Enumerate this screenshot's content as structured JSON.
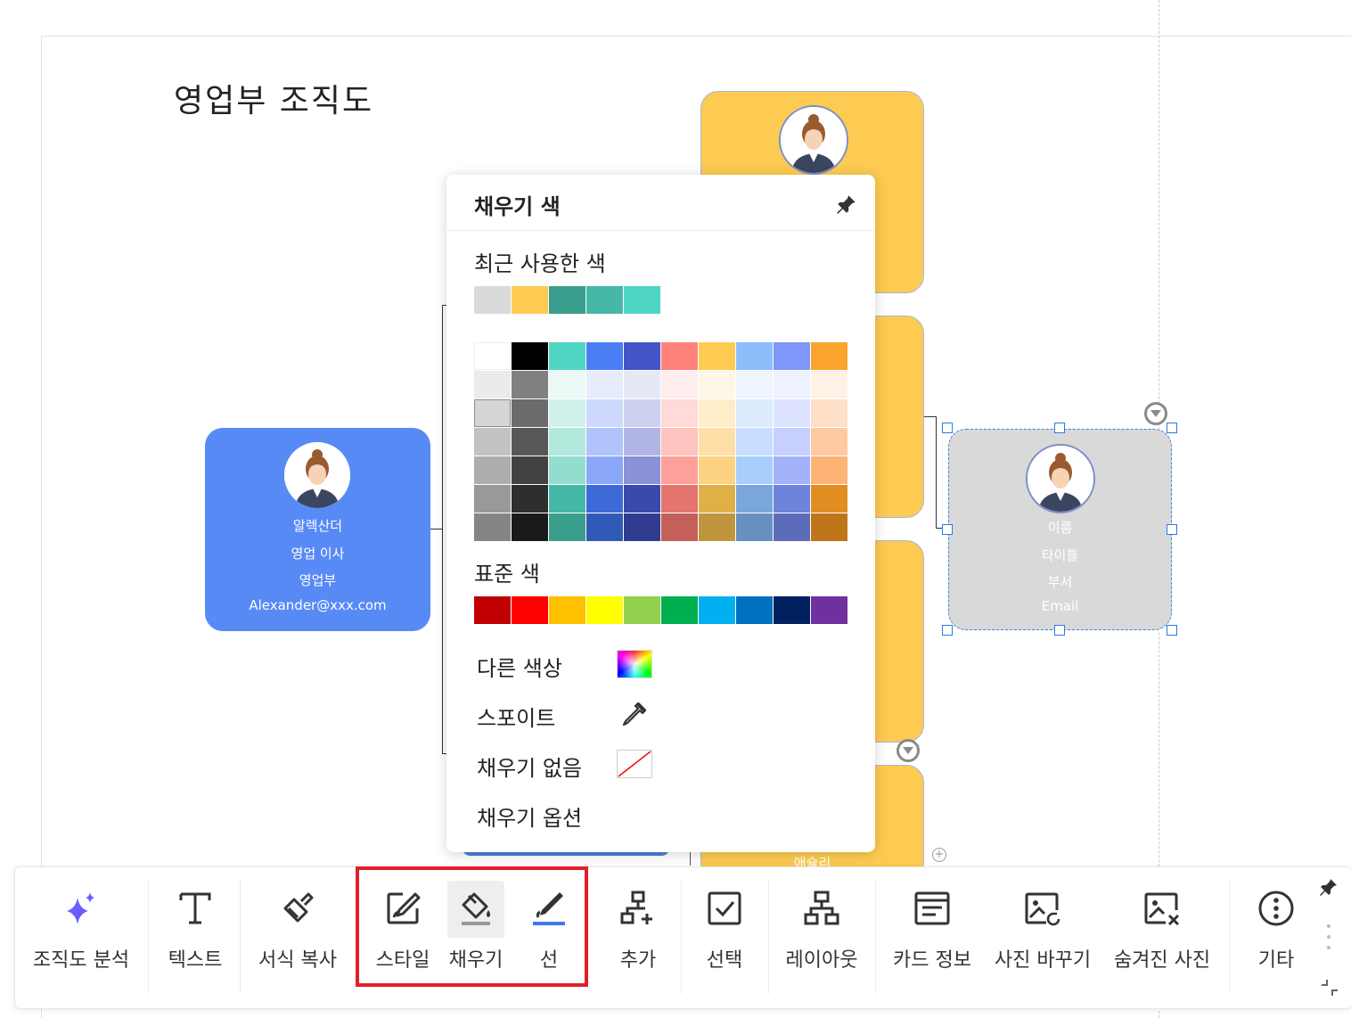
{
  "page_title": "영업부 조직도",
  "cards": {
    "director": {
      "name": "알렉산더",
      "title": "영업 이사",
      "dept": "영업부",
      "email": "Alexander@xxx.com",
      "color": "#588af6"
    },
    "selected": {
      "name": "이름",
      "title": "타이틀",
      "dept": "부서",
      "email": "Email",
      "color": "#d9d9d9"
    },
    "partial_bottom": {
      "name": "애슐리"
    },
    "yellow_color": "#fdcb52"
  },
  "fill_popup": {
    "title": "채우기 색",
    "pin_icon": "pin-icon",
    "recent_label": "최근 사용한 색",
    "recent_colors": [
      "#d9d9d9",
      "#fdcb52",
      "#3a9e8c",
      "#46b8a8",
      "#4fd6c3"
    ],
    "theme_columns": [
      [
        "#ffffff",
        "#ebebeb",
        "#d6d6d6",
        "#c2c2c2",
        "#adadad",
        "#999999",
        "#858585"
      ],
      [
        "#000000",
        "#808080",
        "#6b6b6b",
        "#575757",
        "#424242",
        "#2e2e2e",
        "#1a1a1a"
      ],
      [
        "#4fd6c3",
        "#eaf9f6",
        "#d1f2eb",
        "#b3e9dd",
        "#91dece",
        "#46b8a8",
        "#3a9e8c"
      ],
      [
        "#4a7ef5",
        "#e6ecfd",
        "#ccd9fc",
        "#b0c4fb",
        "#8aa7f8",
        "#3d6ad6",
        "#315ab8"
      ],
      [
        "#4355c6",
        "#e6e8f6",
        "#cdd0ee",
        "#b0b5e4",
        "#8a91d6",
        "#3a4aac",
        "#2f3c90"
      ],
      [
        "#ff837b",
        "#ffeeed",
        "#ffdad8",
        "#ffc3bf",
        "#ff9f99",
        "#e4746d",
        "#c45f59"
      ],
      [
        "#fdcb52",
        "#fff7e6",
        "#ffedc9",
        "#fee0a7",
        "#fdd280",
        "#e0b048",
        "#bf953d"
      ],
      [
        "#8bbefa",
        "#eef5ff",
        "#dceafe",
        "#c8deff",
        "#a9cdfc",
        "#7aa6dc",
        "#678fbf"
      ],
      [
        "#7f96fa",
        "#eef1ff",
        "#dde3fe",
        "#c5d0fd",
        "#a2b2fb",
        "#6e83dc",
        "#5b6cbb"
      ],
      [
        "#fba42b",
        "#fff1e6",
        "#fedfc7",
        "#fec9a0",
        "#fdb276",
        "#e08e22",
        "#bf7519"
      ]
    ],
    "standard_label": "표준 색",
    "standard_colors": [
      "#c00000",
      "#ff0000",
      "#ffc000",
      "#ffff00",
      "#92d050",
      "#00b050",
      "#00b0f0",
      "#0070c0",
      "#002060",
      "#7030a0"
    ],
    "more_colors": "다른 색상",
    "eyedropper": "스포이트",
    "no_fill": "채우기 없음",
    "fill_options": "채우기 옵션"
  },
  "toolbar": {
    "items": [
      {
        "label": "조직도 분석",
        "icon": "sparkle-icon"
      },
      {
        "label": "텍스트",
        "icon": "text-icon"
      },
      {
        "label": "서식 복사",
        "icon": "format-painter-icon"
      },
      {
        "label": "스타일",
        "icon": "style-icon"
      },
      {
        "label": "채우기",
        "icon": "fill-bucket-icon"
      },
      {
        "label": "선",
        "icon": "line-pen-icon"
      },
      {
        "label": "추가",
        "icon": "add-node-icon"
      },
      {
        "label": "선택",
        "icon": "select-checkbox-icon"
      },
      {
        "label": "레이아웃",
        "icon": "layout-tree-icon"
      },
      {
        "label": "카드 정보",
        "icon": "card-info-icon"
      },
      {
        "label": "사진 바꾸기",
        "icon": "replace-photo-icon"
      },
      {
        "label": "숨겨진 사진",
        "icon": "hidden-photo-icon"
      },
      {
        "label": "기타",
        "icon": "more-icon"
      }
    ],
    "accent": "#6a5cff",
    "highlight_color": "#e0202a"
  }
}
